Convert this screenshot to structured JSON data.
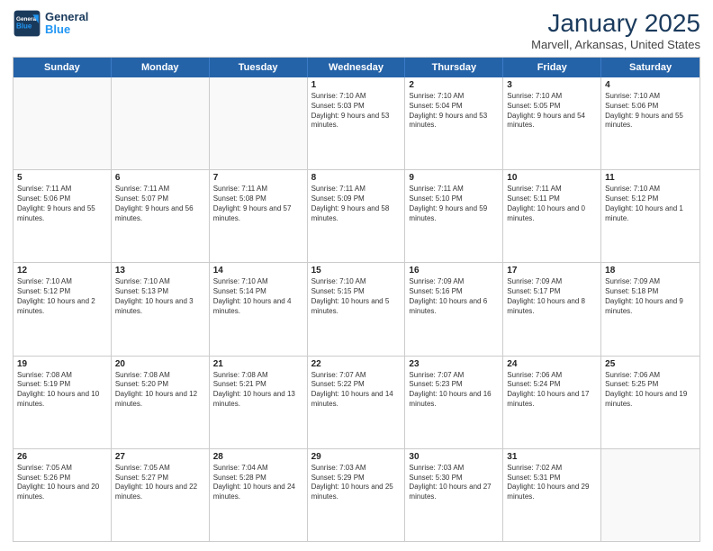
{
  "header": {
    "logo_general": "General",
    "logo_blue": "Blue",
    "month": "January 2025",
    "location": "Marvell, Arkansas, United States"
  },
  "days_of_week": [
    "Sunday",
    "Monday",
    "Tuesday",
    "Wednesday",
    "Thursday",
    "Friday",
    "Saturday"
  ],
  "weeks": [
    [
      {
        "day": "",
        "info": ""
      },
      {
        "day": "",
        "info": ""
      },
      {
        "day": "",
        "info": ""
      },
      {
        "day": "1",
        "info": "Sunrise: 7:10 AM\nSunset: 5:03 PM\nDaylight: 9 hours and 53 minutes."
      },
      {
        "day": "2",
        "info": "Sunrise: 7:10 AM\nSunset: 5:04 PM\nDaylight: 9 hours and 53 minutes."
      },
      {
        "day": "3",
        "info": "Sunrise: 7:10 AM\nSunset: 5:05 PM\nDaylight: 9 hours and 54 minutes."
      },
      {
        "day": "4",
        "info": "Sunrise: 7:10 AM\nSunset: 5:06 PM\nDaylight: 9 hours and 55 minutes."
      }
    ],
    [
      {
        "day": "5",
        "info": "Sunrise: 7:11 AM\nSunset: 5:06 PM\nDaylight: 9 hours and 55 minutes."
      },
      {
        "day": "6",
        "info": "Sunrise: 7:11 AM\nSunset: 5:07 PM\nDaylight: 9 hours and 56 minutes."
      },
      {
        "day": "7",
        "info": "Sunrise: 7:11 AM\nSunset: 5:08 PM\nDaylight: 9 hours and 57 minutes."
      },
      {
        "day": "8",
        "info": "Sunrise: 7:11 AM\nSunset: 5:09 PM\nDaylight: 9 hours and 58 minutes."
      },
      {
        "day": "9",
        "info": "Sunrise: 7:11 AM\nSunset: 5:10 PM\nDaylight: 9 hours and 59 minutes."
      },
      {
        "day": "10",
        "info": "Sunrise: 7:11 AM\nSunset: 5:11 PM\nDaylight: 10 hours and 0 minutes."
      },
      {
        "day": "11",
        "info": "Sunrise: 7:10 AM\nSunset: 5:12 PM\nDaylight: 10 hours and 1 minute."
      }
    ],
    [
      {
        "day": "12",
        "info": "Sunrise: 7:10 AM\nSunset: 5:12 PM\nDaylight: 10 hours and 2 minutes."
      },
      {
        "day": "13",
        "info": "Sunrise: 7:10 AM\nSunset: 5:13 PM\nDaylight: 10 hours and 3 minutes."
      },
      {
        "day": "14",
        "info": "Sunrise: 7:10 AM\nSunset: 5:14 PM\nDaylight: 10 hours and 4 minutes."
      },
      {
        "day": "15",
        "info": "Sunrise: 7:10 AM\nSunset: 5:15 PM\nDaylight: 10 hours and 5 minutes."
      },
      {
        "day": "16",
        "info": "Sunrise: 7:09 AM\nSunset: 5:16 PM\nDaylight: 10 hours and 6 minutes."
      },
      {
        "day": "17",
        "info": "Sunrise: 7:09 AM\nSunset: 5:17 PM\nDaylight: 10 hours and 8 minutes."
      },
      {
        "day": "18",
        "info": "Sunrise: 7:09 AM\nSunset: 5:18 PM\nDaylight: 10 hours and 9 minutes."
      }
    ],
    [
      {
        "day": "19",
        "info": "Sunrise: 7:08 AM\nSunset: 5:19 PM\nDaylight: 10 hours and 10 minutes."
      },
      {
        "day": "20",
        "info": "Sunrise: 7:08 AM\nSunset: 5:20 PM\nDaylight: 10 hours and 12 minutes."
      },
      {
        "day": "21",
        "info": "Sunrise: 7:08 AM\nSunset: 5:21 PM\nDaylight: 10 hours and 13 minutes."
      },
      {
        "day": "22",
        "info": "Sunrise: 7:07 AM\nSunset: 5:22 PM\nDaylight: 10 hours and 14 minutes."
      },
      {
        "day": "23",
        "info": "Sunrise: 7:07 AM\nSunset: 5:23 PM\nDaylight: 10 hours and 16 minutes."
      },
      {
        "day": "24",
        "info": "Sunrise: 7:06 AM\nSunset: 5:24 PM\nDaylight: 10 hours and 17 minutes."
      },
      {
        "day": "25",
        "info": "Sunrise: 7:06 AM\nSunset: 5:25 PM\nDaylight: 10 hours and 19 minutes."
      }
    ],
    [
      {
        "day": "26",
        "info": "Sunrise: 7:05 AM\nSunset: 5:26 PM\nDaylight: 10 hours and 20 minutes."
      },
      {
        "day": "27",
        "info": "Sunrise: 7:05 AM\nSunset: 5:27 PM\nDaylight: 10 hours and 22 minutes."
      },
      {
        "day": "28",
        "info": "Sunrise: 7:04 AM\nSunset: 5:28 PM\nDaylight: 10 hours and 24 minutes."
      },
      {
        "day": "29",
        "info": "Sunrise: 7:03 AM\nSunset: 5:29 PM\nDaylight: 10 hours and 25 minutes."
      },
      {
        "day": "30",
        "info": "Sunrise: 7:03 AM\nSunset: 5:30 PM\nDaylight: 10 hours and 27 minutes."
      },
      {
        "day": "31",
        "info": "Sunrise: 7:02 AM\nSunset: 5:31 PM\nDaylight: 10 hours and 29 minutes."
      },
      {
        "day": "",
        "info": ""
      }
    ]
  ]
}
